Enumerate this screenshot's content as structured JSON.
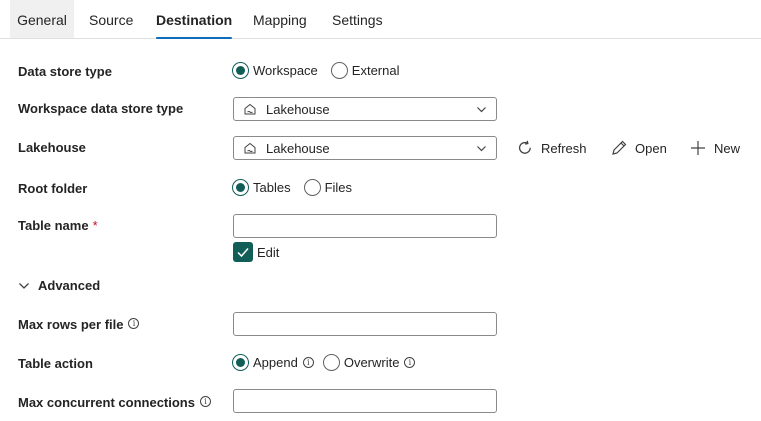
{
  "tabs": [
    {
      "label": "General"
    },
    {
      "label": "Source"
    },
    {
      "label": "Destination"
    },
    {
      "label": "Mapping"
    },
    {
      "label": "Settings"
    }
  ],
  "active_tab": "Destination",
  "accent_color": "#115e59",
  "data_store_type": {
    "label": "Data store type",
    "options": [
      "Workspace",
      "External"
    ],
    "selected": "Workspace"
  },
  "workspace_data_store_type": {
    "label": "Workspace data store type",
    "value": "Lakehouse",
    "icon": "lakehouse-icon"
  },
  "lakehouse": {
    "label": "Lakehouse",
    "value": "Lakehouse",
    "icon": "lakehouse-icon",
    "actions": {
      "refresh": "Refresh",
      "open": "Open",
      "new": "New"
    }
  },
  "root_folder": {
    "label": "Root folder",
    "options": [
      "Tables",
      "Files"
    ],
    "selected": "Tables"
  },
  "table_name": {
    "label": "Table name",
    "required_mark": "*",
    "value": "",
    "edit_label": "Edit",
    "edit_checked": true
  },
  "advanced": {
    "label": "Advanced",
    "expanded": true
  },
  "max_rows_per_file": {
    "label": "Max rows per file",
    "value": ""
  },
  "table_action": {
    "label": "Table action",
    "options": [
      "Append",
      "Overwrite"
    ],
    "selected": "Append"
  },
  "max_concurrent_connections": {
    "label": "Max concurrent connections",
    "value": ""
  },
  "info_glyph": "i"
}
